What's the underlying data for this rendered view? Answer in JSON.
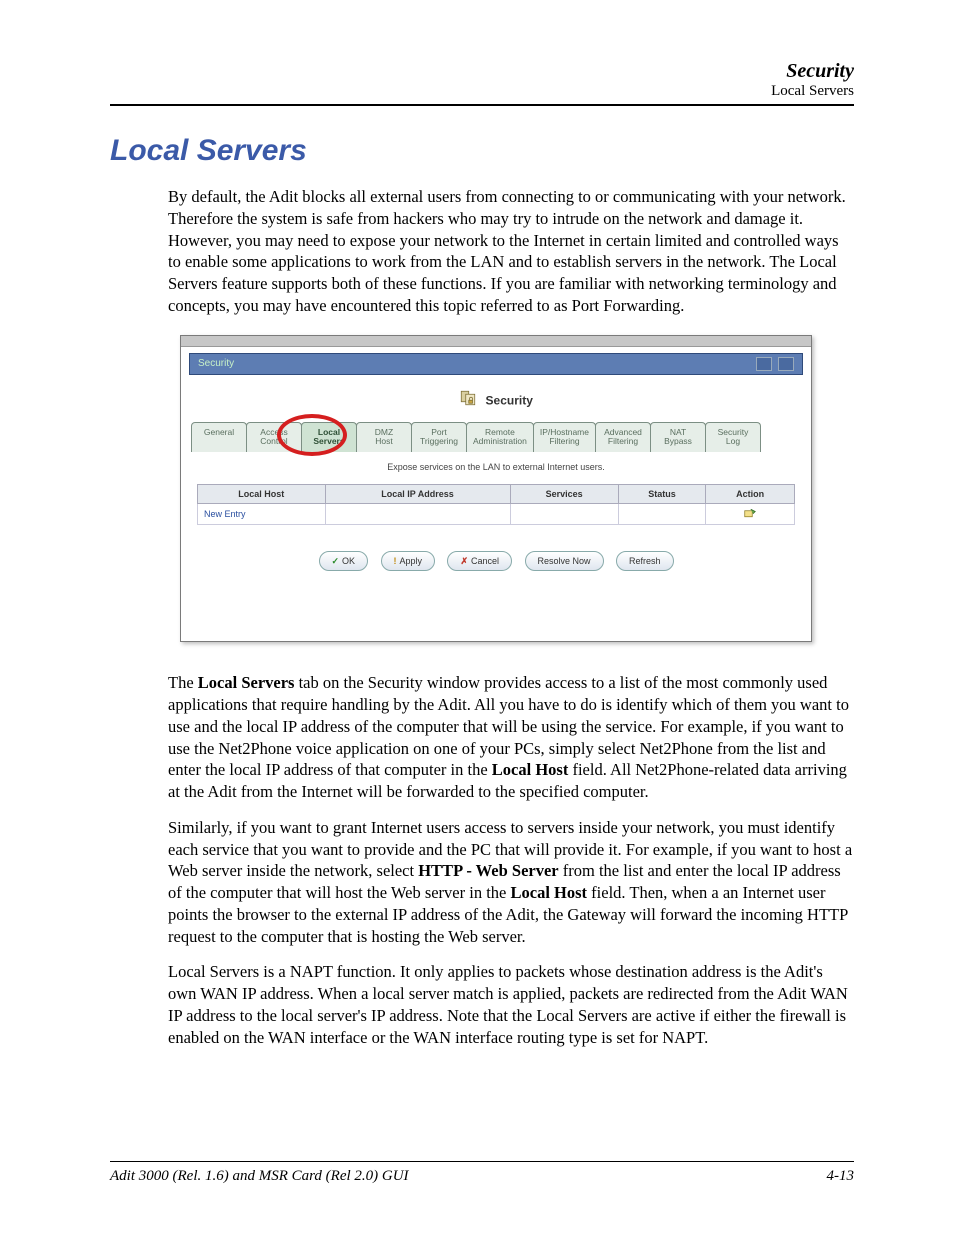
{
  "header": {
    "title": "Security",
    "subtitle": "Local Servers"
  },
  "section_title": "Local Servers",
  "para1": "By default, the Adit blocks all external users from connecting to or communicating with your network. Therefore the system is safe from hackers who may try to intrude on the network and damage it. However, you may need to expose your network to the Internet in certain limited and controlled ways to enable some applications to work from the LAN and to establish servers in the network. The Local Servers feature supports both of these functions. If you are familiar with networking terminology and concepts, you may have encountered this topic referred to as Port Forwarding.",
  "screenshot": {
    "titlebar": "Security",
    "page_heading": "Security",
    "tabs": [
      "General",
      "Access\nControl",
      "Local\nServers",
      "DMZ\nHost",
      "Port\nTriggering",
      "Remote\nAdministration",
      "IP/Hostname\nFiltering",
      "Advanced\nFiltering",
      "NAT\nBypass",
      "Security\nLog"
    ],
    "active_tab_index": 2,
    "tab_subtitle": "Expose services on the LAN to external Internet users.",
    "table_headers": [
      "Local Host",
      "Local IP Address",
      "Services",
      "Status",
      "Action"
    ],
    "new_entry_label": "New Entry",
    "buttons": {
      "ok": "OK",
      "apply": "Apply",
      "cancel": "Cancel",
      "resolve": "Resolve Now",
      "refresh": "Refresh"
    }
  },
  "para2_pre": "The ",
  "para2_b1": "Local Servers",
  "para2_mid1": " tab on the Security window provides access to a list of the most commonly used applications that require handling by the Adit.  All you have to do is identify which of them you want to use and the local IP address of the computer that will be using the service. For example, if you want to use the Net2Phone voice application on one of your PCs, simply select Net2Phone from the list and enter the local IP address of that computer in the ",
  "para2_b2": "Local Host",
  "para2_post": " field. All Net2Phone-related data arriving at the Adit from the Internet will be forwarded to the specified computer.",
  "para3_pre": "Similarly, if you want to grant Internet users access to servers inside your network, you must identify each service that you want to provide and the PC that will provide it. For example, if you want to host a Web server inside the network, select ",
  "para3_b1": "HTTP - Web Server",
  "para3_mid": " from the list and enter the local IP address of the computer that will host the Web server in the ",
  "para3_b2": "Local Host",
  "para3_post": " field. Then, when a an Internet user points the browser to the external IP address of the Adit, the Gateway will forward the incoming HTTP request to the computer that is hosting the Web server.",
  "para4": "Local Servers is a NAPT function. It only applies to packets whose destination address is the Adit's own WAN IP address. When a local server match is applied, packets are redirected from the Adit WAN IP address to the local server's IP address. Note that the Local Servers are active if either the firewall is enabled on the WAN interface or the WAN interface routing type is set for NAPT.",
  "footer": {
    "left": "Adit 3000 (Rel. 1.6) and MSR Card (Rel 2.0) GUI",
    "right": "4-13"
  }
}
